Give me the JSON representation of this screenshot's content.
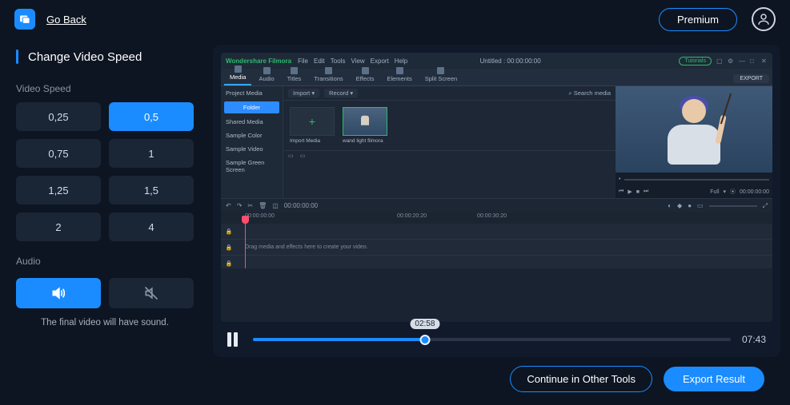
{
  "topbar": {
    "go_back": "Go Back",
    "premium": "Premium"
  },
  "sidebar": {
    "title": "Change Video Speed",
    "speed_label": "Video Speed",
    "speeds": [
      "0,25",
      "0,5",
      "0,75",
      "1",
      "1,25",
      "1,5",
      "2",
      "4"
    ],
    "active_speed_index": 1,
    "audio_label": "Audio",
    "audio_desc": "The final video will have sound."
  },
  "editor": {
    "brand": "Wondershare Filmora",
    "menus": [
      "File",
      "Edit",
      "Tools",
      "View",
      "Export",
      "Help"
    ],
    "project_status": "Untitled : 00:00:00:00",
    "tutorials": "Tutorials",
    "tabs": [
      "Media",
      "Audio",
      "Titles",
      "Transitions",
      "Effects",
      "Elements",
      "Split Screen"
    ],
    "export": "EXPORT",
    "left_items": [
      "Project Media",
      "Folder",
      "Shared Media",
      "Sample Color",
      "Sample Video",
      "Sample Green Screen"
    ],
    "mid_bar": {
      "import": "Import",
      "record": "Record",
      "search_ph": "Search media"
    },
    "tile_import": "Import Media",
    "tile_clip": "wand light filmora",
    "preview_controls": {
      "full": "Full"
    },
    "timeline_times": [
      "00:00:00:00",
      "00:00:20:20",
      "00:00:30:20"
    ],
    "drag_hint": "Drag media and effects here to create your video."
  },
  "player": {
    "current": "02:58",
    "total": "07:43"
  },
  "footer": {
    "continue": "Continue in Other Tools",
    "export": "Export Result"
  }
}
